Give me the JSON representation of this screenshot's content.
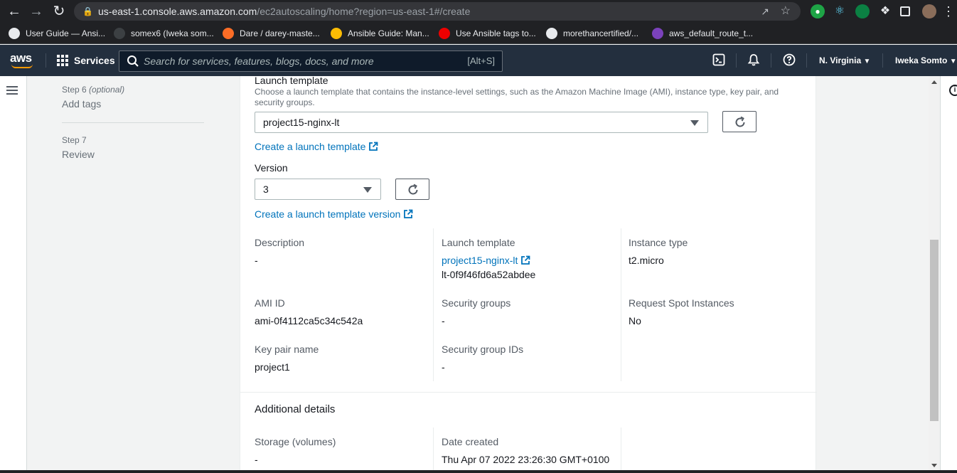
{
  "browser": {
    "url_host": "us-east-1.console.aws.amazon.com",
    "url_path": "/ec2autoscaling/home?region=us-east-1#/create",
    "bookmarks": [
      {
        "label": "User Guide — Ansi...",
        "color": "#e8eaed"
      },
      {
        "label": "somex6 (Iweka som...",
        "color": "#3c4043"
      },
      {
        "label": "Dare / darey-maste...",
        "color": "#fc6d26"
      },
      {
        "label": "Ansible Guide: Man...",
        "color": "#fbbc04"
      },
      {
        "label": "Use Ansible tags to...",
        "color": "#ee0000"
      },
      {
        "label": "morethancertified/...",
        "color": "#e8eaed"
      },
      {
        "label": "aws_default_route_t...",
        "color": "#7b42bc"
      }
    ]
  },
  "awsnav": {
    "logo": "aws",
    "services": "Services",
    "search_placeholder": "Search for services, features, blogs, docs, and more",
    "search_shortcut": "[Alt+S]",
    "region": "N. Virginia",
    "user": "Iweka Somto"
  },
  "steps": [
    {
      "label": "Step 6",
      "optional": "(optional)",
      "name": "Add tags"
    },
    {
      "label": "Step 7",
      "optional": "",
      "name": "Review"
    }
  ],
  "launch_template": {
    "label": "Launch template",
    "description": "Choose a launch template that contains the instance-level settings, such as the Amazon Machine Image (AMI), instance type, key pair, and security groups.",
    "selected": "project15-nginx-lt",
    "create_link": "Create a launch template",
    "version_label": "Version",
    "version_selected": "3",
    "create_version_link": "Create a launch template version"
  },
  "details": {
    "description_label": "Description",
    "description_value": "-",
    "lt_label": "Launch template",
    "lt_link": "project15-nginx-lt",
    "lt_id": "lt-0f9f46fd6a52abdee",
    "instance_type_label": "Instance type",
    "instance_type_value": "t2.micro",
    "ami_label": "AMI ID",
    "ami_value": "ami-0f4112ca5c34c542a",
    "sg_label": "Security groups",
    "sg_value": "-",
    "spot_label": "Request Spot Instances",
    "spot_value": "No",
    "keypair_label": "Key pair name",
    "keypair_value": "project1",
    "sgid_label": "Security group IDs",
    "sgid_value": "-"
  },
  "additional": {
    "title": "Additional details",
    "storage_label": "Storage (volumes)",
    "storage_value": "-",
    "date_label": "Date created",
    "date_value": "Thu Apr 07 2022 23:26:30 GMT+0100"
  }
}
